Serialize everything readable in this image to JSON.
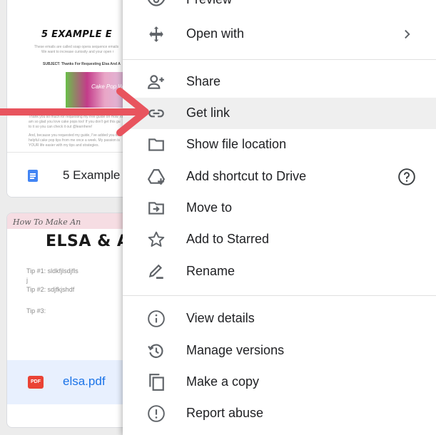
{
  "cards": [
    {
      "name": "5 Example",
      "preview": {
        "title": "5 EXAMPLE E",
        "intro_line1": "These emails are called soap opera sequence emails",
        "intro_line2": "We want to increase curiosity and your open r",
        "subject": "SUBJECT: Thanks For Requesting Elsa And A",
        "image_text": "Cake Pop Wand",
        "body_line1": "Thank you so much for requesting my free guide on How To",
        "body_line2": "am so glad you love cake pops too! If you don't get this gu",
        "body_line3": "to it so you can check it out @learnhere!",
        "body_line4": "And, because you requested my guide, I've added you to my",
        "body_line5": "helpful cake pop tips from me once a week. My passion is",
        "body_line6": "YOUR life easier with my tips and strategies."
      },
      "icon": "google-docs-icon"
    },
    {
      "name": "elsa.pdf",
      "preview": {
        "script_title": "How To Make An",
        "title": "ELSA & A",
        "tip1": "Tip #1: sldkfjlsdjfls",
        "tip1b": "j",
        "tip2": "Tip #2: sdjfkjshdf",
        "tip3": "Tip #3:"
      },
      "icon": "pdf-icon",
      "icon_text": "PDF"
    }
  ],
  "menu": {
    "items": [
      {
        "label": "Preview",
        "icon": "eye-icon"
      },
      {
        "label": "Open with",
        "icon": "open-with-icon",
        "right": "chevron-right-icon"
      },
      {
        "label": "Share",
        "icon": "person-add-icon"
      },
      {
        "label": "Get link",
        "icon": "link-icon",
        "active": true
      },
      {
        "label": "Show file location",
        "icon": "folder-icon"
      },
      {
        "label": "Add shortcut to Drive",
        "icon": "add-shortcut-icon",
        "right": "help-icon"
      },
      {
        "label": "Move to",
        "icon": "move-to-icon"
      },
      {
        "label": "Add to Starred",
        "icon": "star-icon"
      },
      {
        "label": "Rename",
        "icon": "pencil-icon"
      },
      {
        "label": "View details",
        "icon": "info-icon"
      },
      {
        "label": "Manage versions",
        "icon": "history-icon"
      },
      {
        "label": "Make a copy",
        "icon": "copy-icon"
      },
      {
        "label": "Report abuse",
        "icon": "report-icon"
      }
    ]
  },
  "colors": {
    "active_row": "#efefef",
    "arrow": "#e8545e",
    "doc_blue": "#4285f4",
    "pdf_red": "#ea4335",
    "selected_card": "#e8f0fe"
  }
}
